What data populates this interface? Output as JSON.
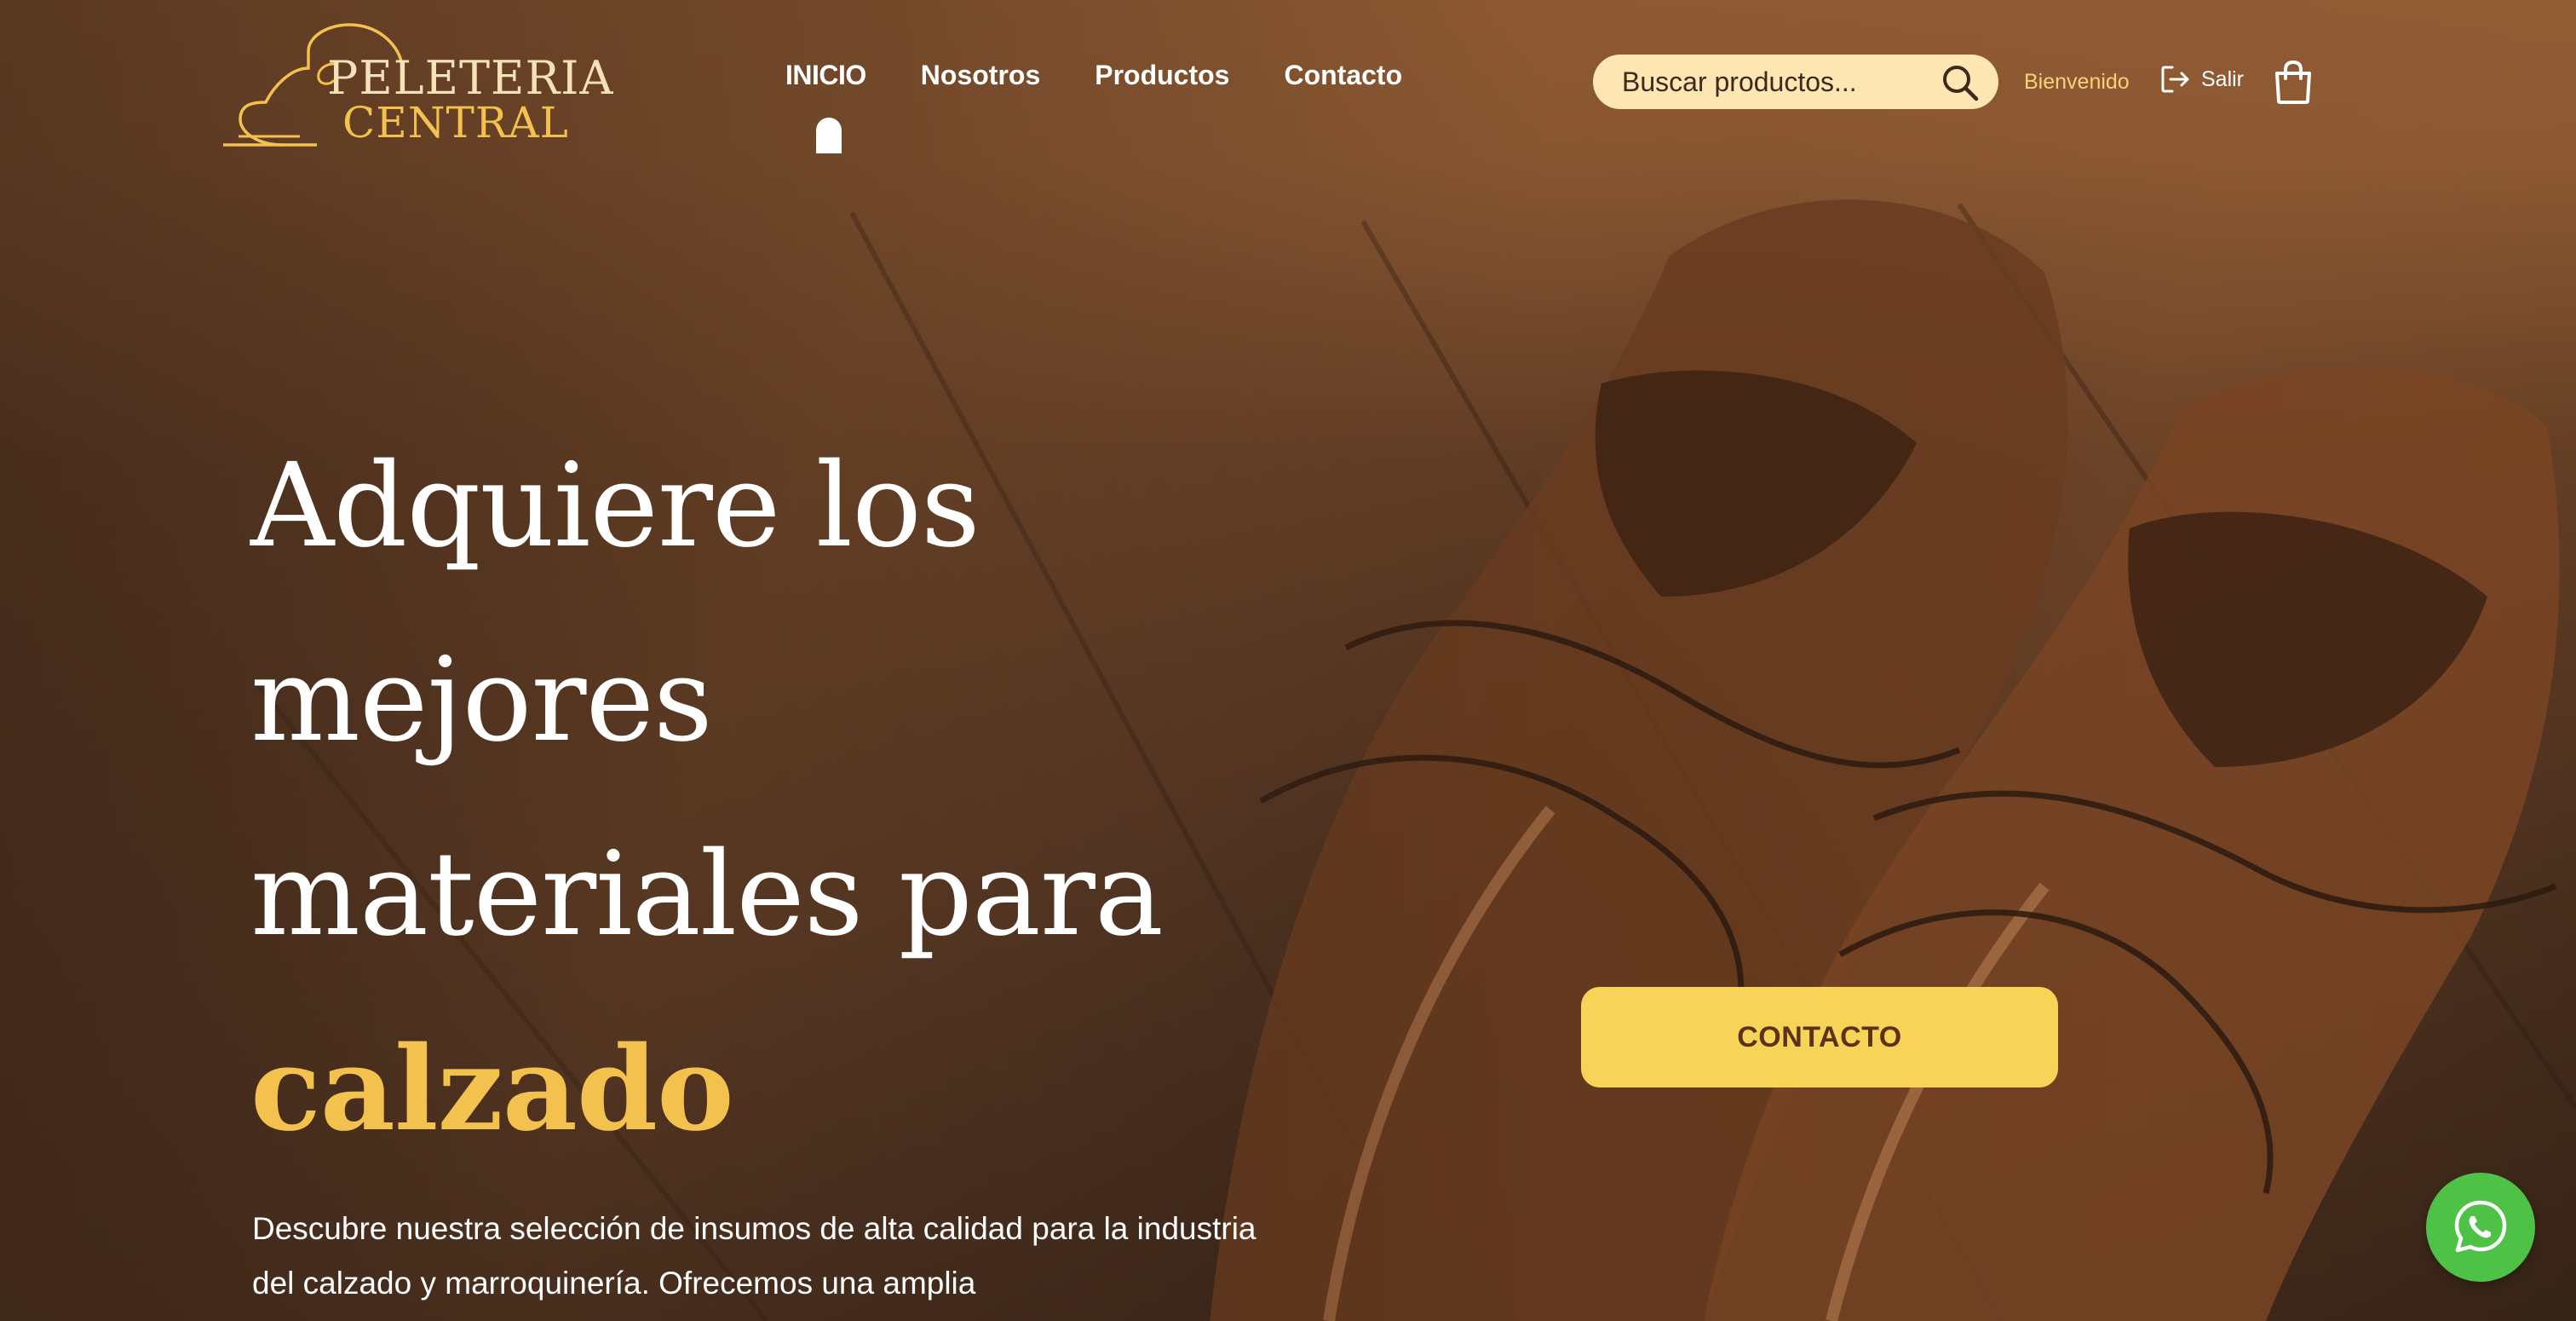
{
  "brand": {
    "line1": "PELETERIA",
    "line2": "CENTRAL"
  },
  "nav": {
    "items": [
      {
        "label": "INICIO",
        "active": true
      },
      {
        "label": "Nosotros"
      },
      {
        "label": "Productos"
      },
      {
        "label": "Contacto"
      }
    ]
  },
  "search": {
    "placeholder": "Buscar productos...",
    "icon": "search-icon"
  },
  "user": {
    "welcome": "Bienvenido",
    "logout_label": "Salir",
    "logout_icon": "logout-icon",
    "cart_icon": "shopping-bag-icon"
  },
  "hero": {
    "title_line1": "Adquiere los",
    "title_line2": "mejores",
    "title_line3": "materiales para",
    "title_accent": "calzado",
    "description": "Descubre nuestra selección de insumos de alta calidad para la industria del calzado y marroquinería. Ofrecemos una amplia",
    "cta_label": "CONTACTO"
  },
  "floating": {
    "whatsapp_icon": "whatsapp-icon"
  },
  "colors": {
    "header_bg": "#925c34",
    "accent_yellow": "#f2c14e",
    "cta_bg": "#f7d458",
    "cta_text": "#5c3318",
    "search_bg": "#fde6b2",
    "welcome_text": "#f8d27a",
    "whatsapp_green": "#4dc247"
  }
}
